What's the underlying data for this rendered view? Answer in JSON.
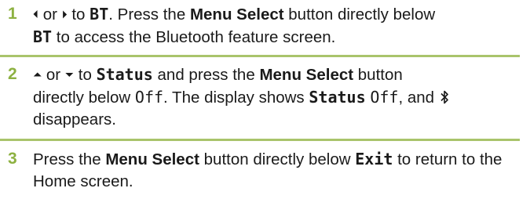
{
  "steps": [
    {
      "number": "1",
      "left_icon": "left-arrow-icon",
      "or1": "or",
      "right_icon": "right-arrow-icon",
      "to1": "to",
      "target": "BT",
      "period1": ". Press the",
      "menu_select": "Menu Select",
      "button_below": "button directly below",
      "below_target": "BT",
      "rest": "to access the Bluetooth feature screen."
    },
    {
      "number": "2",
      "up_icon": "up-arrow-icon",
      "or1": "or",
      "down_icon": "down-arrow-icon",
      "to1": "to",
      "target": "Status",
      "and_press": "and press the",
      "menu_select": "Menu Select",
      "button_below": "button",
      "directly_below": "directly below",
      "below_target": "Off",
      "display_shows": ". The display shows",
      "status_word": "Status",
      "off_word": "Off",
      "and_word": ", and",
      "bluetooth_icon": "bluetooth-icon",
      "disappears": "disappears."
    },
    {
      "number": "3",
      "press_the": "Press the",
      "menu_select": "Menu Select",
      "button_below": "button directly below",
      "below_target": "Exit",
      "rest": "to return to the Home screen."
    }
  ],
  "colors": {
    "number": "#8db141",
    "divider": "#a9c46b",
    "text": "#1a1a1a"
  }
}
